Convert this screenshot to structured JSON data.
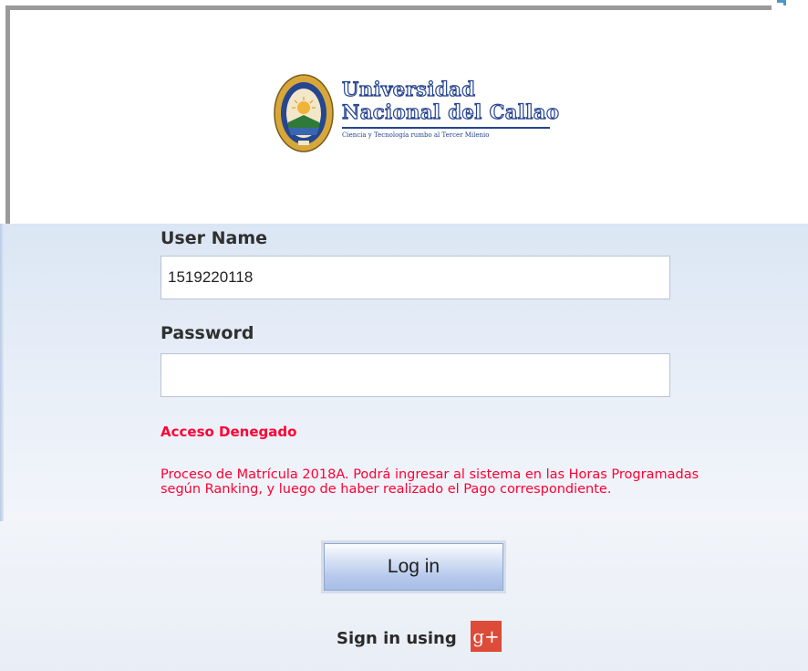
{
  "logo": {
    "line1": "Universidad",
    "line2": "Nacional del Callao",
    "tagline": "Ciencia y Tecnología rumbo al Tercer Milenio"
  },
  "form": {
    "username_label": "User Name",
    "username_value": "1519220118",
    "password_label": "Password",
    "password_value": ""
  },
  "error": {
    "title": "Acceso Denegado",
    "message": "Proceso de Matrícula 2018A. Podrá ingresar al sistema en las Horas Programadas según Ranking, y luego de haber realizado el Pago correspondiente."
  },
  "login_button_label": "Log in",
  "social": {
    "sign_in_text": "Sign in using",
    "gplus_label": "g+"
  },
  "colors": {
    "error": "#ff0033",
    "brand_blue": "#25438f",
    "gplus": "#dd4b39"
  },
  "icons": {
    "seal": "university-seal-icon",
    "gplus": "google-plus-icon"
  }
}
